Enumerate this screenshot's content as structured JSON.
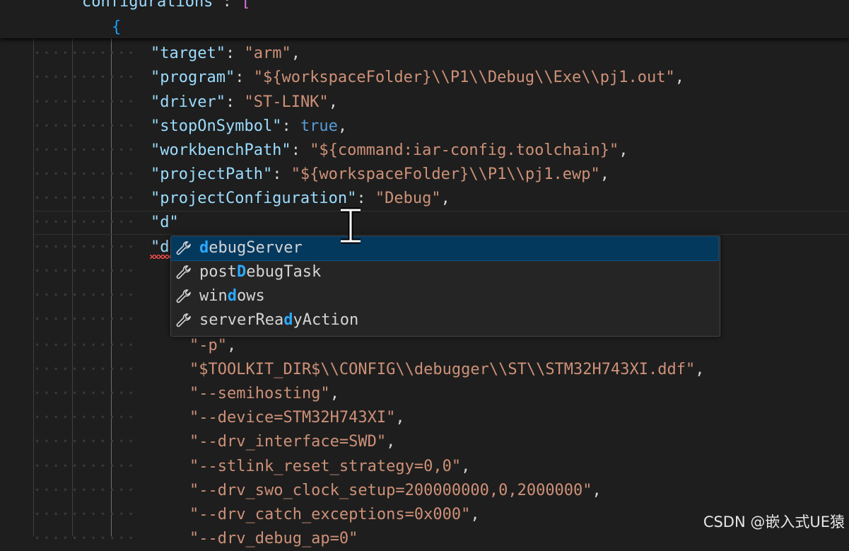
{
  "sticky": {
    "configurations_key": "configurations",
    "configurations_sep": " : ",
    "open_bracket": "[",
    "open_brace": "{"
  },
  "lines": [
    {
      "key": "\"target\"",
      "sep": ": ",
      "value": "\"arm\"",
      "tail": ","
    },
    {
      "key": "\"program\"",
      "sep": ": ",
      "value": "\"${workspaceFolder}\\\\P1\\\\Debug\\\\Exe\\\\pj1.out\"",
      "tail": ","
    },
    {
      "key": "\"driver\"",
      "sep": ": ",
      "value": "\"ST-LINK\"",
      "tail": ","
    },
    {
      "key": "\"stopOnSymbol\"",
      "sep": ": ",
      "value": "true",
      "tail": ","
    },
    {
      "key": "\"workbenchPath\"",
      "sep": ": ",
      "value": "\"${command:iar-config.toolchain}\"",
      "tail": ","
    },
    {
      "key": "\"projectPath\"",
      "sep": ": ",
      "value": "\"${workspaceFolder}\\\\P1\\\\pj1.ewp\"",
      "tail": ","
    },
    {
      "key": "\"projectConfiguration\"",
      "sep": ": ",
      "value": "\"Debug\"",
      "tail": ","
    },
    {
      "key": "\"d\"",
      "sep": "",
      "value": "",
      "tail": ""
    },
    {
      "key": "\"d",
      "sep": "",
      "value": "",
      "tail": ""
    }
  ],
  "array_lines": [
    {
      "value": "\"-p\"",
      "tail": ","
    },
    {
      "value": "\"$TOOLKIT_DIR$\\\\CONFIG\\\\debugger\\\\ST\\\\STM32H743XI.ddf\"",
      "tail": ","
    },
    {
      "value": "\"--semihosting\"",
      "tail": ","
    },
    {
      "value": "\"--device=STM32H743XI\"",
      "tail": ","
    },
    {
      "value": "\"--drv_interface=SWD\"",
      "tail": ","
    },
    {
      "value": "\"--stlink_reset_strategy=0,0\"",
      "tail": ","
    },
    {
      "value": "\"--drv_swo_clock_setup=200000000,0,2000000\"",
      "tail": ","
    },
    {
      "value": "\"--drv_catch_exceptions=0x000\"",
      "tail": ","
    },
    {
      "value": "\"--drv_debug_ap=0\"",
      "tail": ""
    }
  ],
  "suggestions": [
    {
      "pre": "",
      "match": "d",
      "post": "ebugServer",
      "icon": "wrench-icon",
      "selected": true
    },
    {
      "pre": "post",
      "match": "D",
      "post": "ebugTask",
      "icon": "wrench-icon",
      "selected": false
    },
    {
      "pre": "win",
      "match": "d",
      "post": "ows",
      "icon": "wrench-icon",
      "selected": false
    },
    {
      "pre": "serverRea",
      "match": "d",
      "post": "yAction",
      "icon": "wrench-icon",
      "selected": false
    }
  ],
  "watermark": "CSDN @嵌入式UE猿",
  "colors": {
    "background": "#1e1e1e",
    "key": "#9cdcfe",
    "string": "#ce9178",
    "keyword": "#569cd6",
    "match_highlight": "#2aaaff",
    "selected_row": "#04395e"
  }
}
